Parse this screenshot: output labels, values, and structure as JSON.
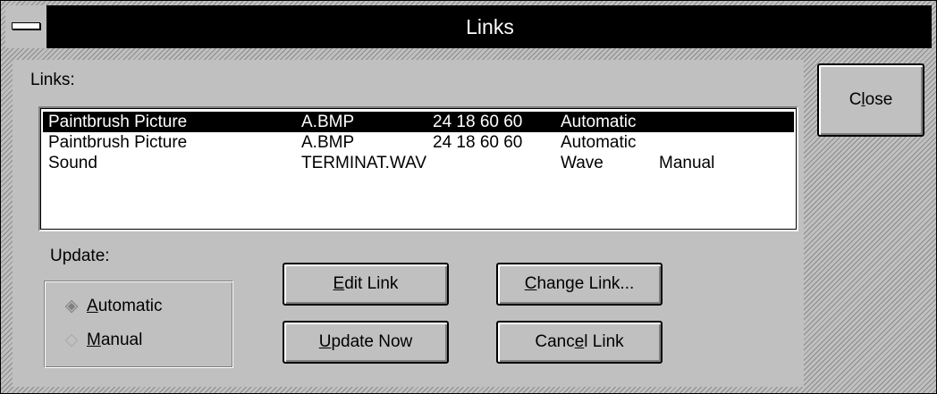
{
  "window": {
    "title": "Links"
  },
  "links": {
    "label": "Links:",
    "columns": [
      "source",
      "file",
      "item",
      "type",
      "update"
    ],
    "rows": [
      {
        "source": "Paintbrush Picture",
        "file": "A.BMP",
        "item": "24 18 60 60",
        "type": "Automatic",
        "update": "",
        "selected": true
      },
      {
        "source": "Paintbrush Picture",
        "file": "A.BMP",
        "item": "24 18 60 60",
        "type": "Automatic",
        "update": "",
        "selected": false
      },
      {
        "source": "Sound",
        "file": "TERMINAT.WAV",
        "item": "",
        "type": "Wave",
        "update": "Manual",
        "selected": false
      }
    ]
  },
  "update": {
    "label": "Update:",
    "selected": "automatic",
    "automatic": {
      "mnemonic": "A",
      "rest": "utomatic"
    },
    "manual": {
      "mnemonic": "M",
      "rest": "anual"
    }
  },
  "buttons": {
    "close": {
      "pre": "C",
      "mnemonic": "l",
      "post": "ose"
    },
    "edit_link": {
      "pre": "",
      "mnemonic": "E",
      "post": "dit Link"
    },
    "update_now": {
      "pre": "",
      "mnemonic": "U",
      "post": "pdate Now"
    },
    "change_link": {
      "pre": "",
      "mnemonic": "C",
      "post": "hange Link..."
    },
    "cancel_link": {
      "pre": "Canc",
      "mnemonic": "e",
      "post": "l Link"
    }
  },
  "icons": {
    "system_menu": "system-menu-icon",
    "radio_selected": "◈",
    "radio_unselected": "◇"
  }
}
